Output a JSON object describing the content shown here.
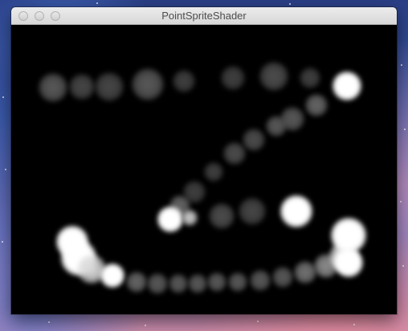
{
  "window": {
    "title": "PointSpriteShader"
  },
  "titlebar": {
    "buttons": [
      {
        "name": "close-button",
        "icon": "close-icon"
      },
      {
        "name": "minimize-button",
        "icon": "minimize-icon"
      },
      {
        "name": "zoom-button",
        "icon": "zoom-icon"
      }
    ]
  },
  "canvas": {
    "background": "#000000",
    "sprite_color": "#ffffff"
  }
}
